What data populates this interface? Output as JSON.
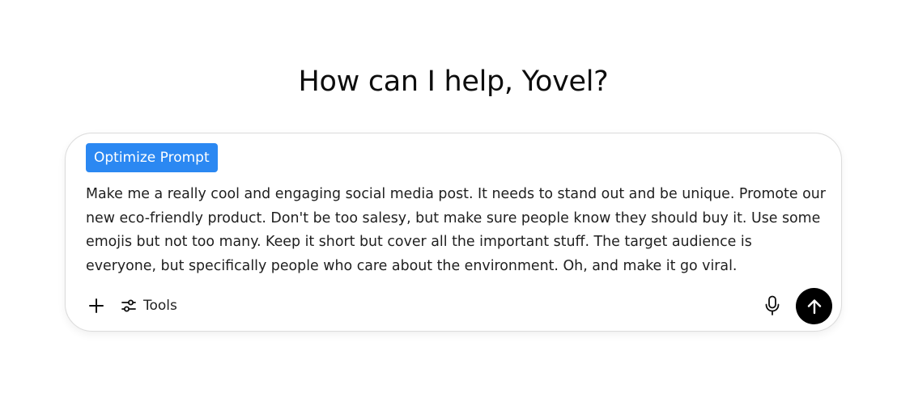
{
  "greeting": "How can I help, Yovel?",
  "composer": {
    "optimize_label": "Optimize Prompt",
    "prompt_text": "Make me a really cool and engaging social media post. It needs to stand out and be unique. Promote our new eco-friendly product. Don't be too salesy, but make sure people know they should buy it. Use some emojis but not too many. Keep it short but cover all the important stuff. The target audience is everyone, but specifically people who care about the environment. Oh, and make it go viral.",
    "tools_label": "Tools",
    "icons": {
      "add": "plus-icon",
      "tools": "sliders-icon",
      "voice": "microphone-icon",
      "send": "arrow-up-icon"
    },
    "colors": {
      "optimize_button": "#2b88f2",
      "send_button": "#000000"
    }
  }
}
